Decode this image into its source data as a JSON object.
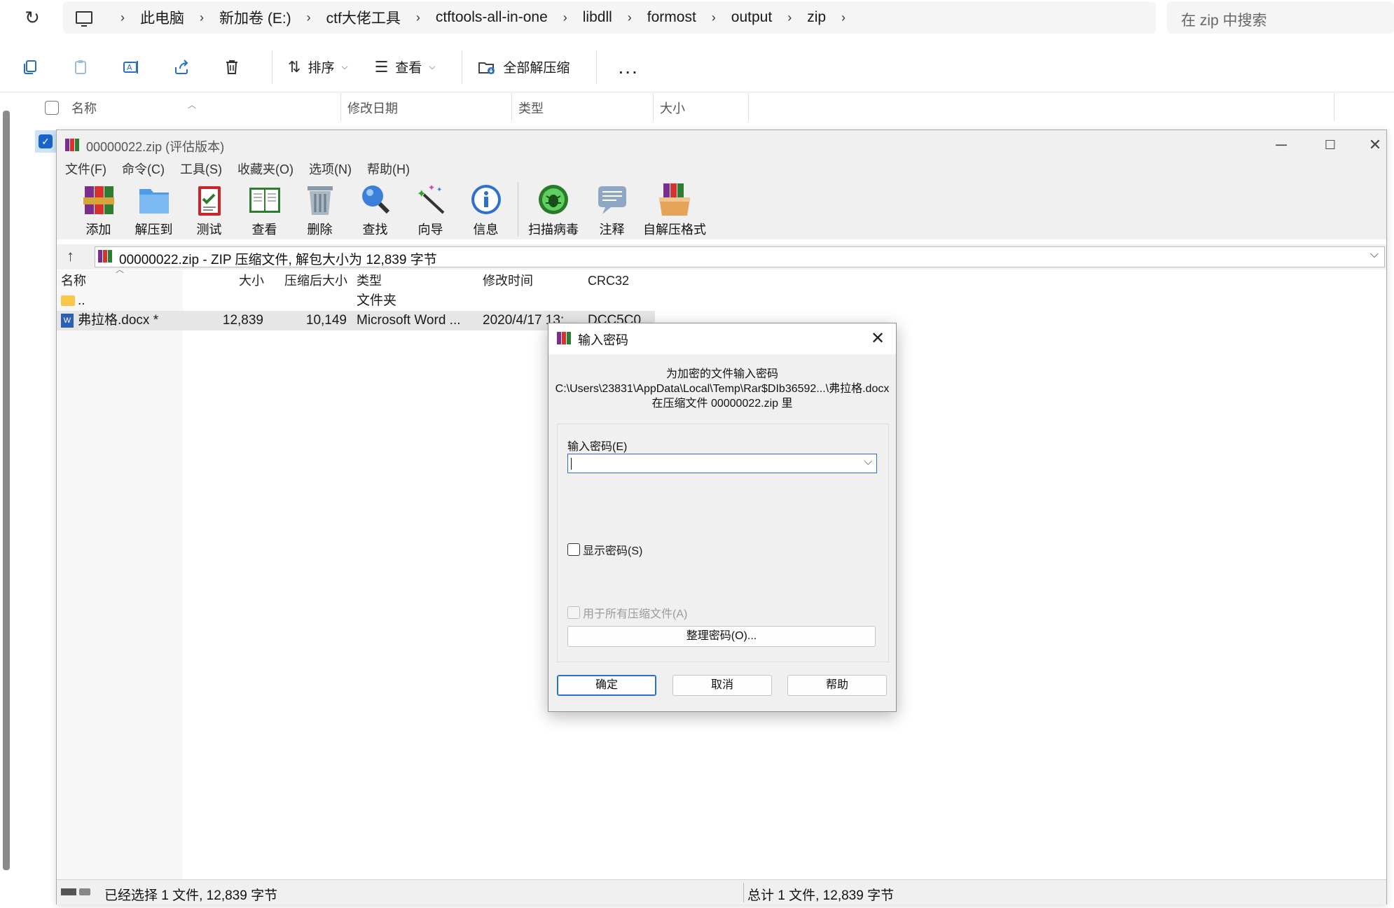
{
  "explorer": {
    "breadcrumbs": [
      "此电脑",
      "新加卷 (E:)",
      "ctf大佬工具",
      "ctftools-all-in-one",
      "libdll",
      "formost",
      "output",
      "zip"
    ],
    "search_placeholder": "在 zip 中搜索",
    "toolbar": {
      "sort_label": "排序",
      "view_label": "查看",
      "extract_all_label": "全部解压缩",
      "more_label": "..."
    },
    "columns": [
      "名称",
      "修改日期",
      "类型",
      "大小"
    ]
  },
  "winrar": {
    "title": "00000022.zip (评估版本)",
    "menu": [
      "文件(F)",
      "命令(C)",
      "工具(S)",
      "收藏夹(O)",
      "选项(N)",
      "帮助(H)"
    ],
    "tools": [
      {
        "label": "添加",
        "icon": "add-archive-icon"
      },
      {
        "label": "解压到",
        "icon": "extract-to-icon"
      },
      {
        "label": "测试",
        "icon": "test-icon"
      },
      {
        "label": "查看",
        "icon": "view-book-icon"
      },
      {
        "label": "删除",
        "icon": "trash-icon"
      },
      {
        "label": "查找",
        "icon": "magnifier-icon"
      },
      {
        "label": "向导",
        "icon": "wizard-wand-icon"
      },
      {
        "label": "信息",
        "icon": "info-icon"
      },
      {
        "label": "扫描病毒",
        "icon": "virus-scan-icon"
      },
      {
        "label": "注释",
        "icon": "comment-icon"
      },
      {
        "label": "自解压格式",
        "icon": "sfx-box-icon"
      }
    ],
    "path": "00000022.zip - ZIP 压缩文件, 解包大小为 12,839 字节",
    "columns": {
      "name": "名称",
      "size": "大小",
      "packed": "压缩后大小",
      "type": "类型",
      "modified": "修改时间",
      "crc": "CRC32"
    },
    "rows": [
      {
        "name": "..",
        "size": "",
        "packed": "",
        "type": "文件夹",
        "modified": "",
        "crc": ""
      },
      {
        "name": "弗拉格.docx *",
        "size": "12,839",
        "packed": "10,149",
        "type": "Microsoft Word ...",
        "modified": "2020/4/17 13:...",
        "crc": "DCC5C0..."
      }
    ],
    "status_left": "已经选择 1 文件, 12,839 字节",
    "status_right": "总计 1 文件, 12,839 字节"
  },
  "dialog": {
    "title": "输入密码",
    "info_line1": "为加密的文件输入密码",
    "info_line2": "C:\\Users\\23831\\AppData\\Local\\Temp\\Rar$DIb36592...\\弗拉格.docx",
    "info_line3": "在压缩文件 00000022.zip 里",
    "password_label": "输入密码(E)",
    "password_value": "",
    "show_password_label": "显示密码(S)",
    "use_for_all_label": "用于所有压缩文件(A)",
    "organize_label": "整理密码(O)...",
    "ok_label": "确定",
    "cancel_label": "取消",
    "help_label": "帮助"
  },
  "colors": {
    "accent": "#2a6fd6",
    "explorer_selection": "#cde1f7"
  }
}
